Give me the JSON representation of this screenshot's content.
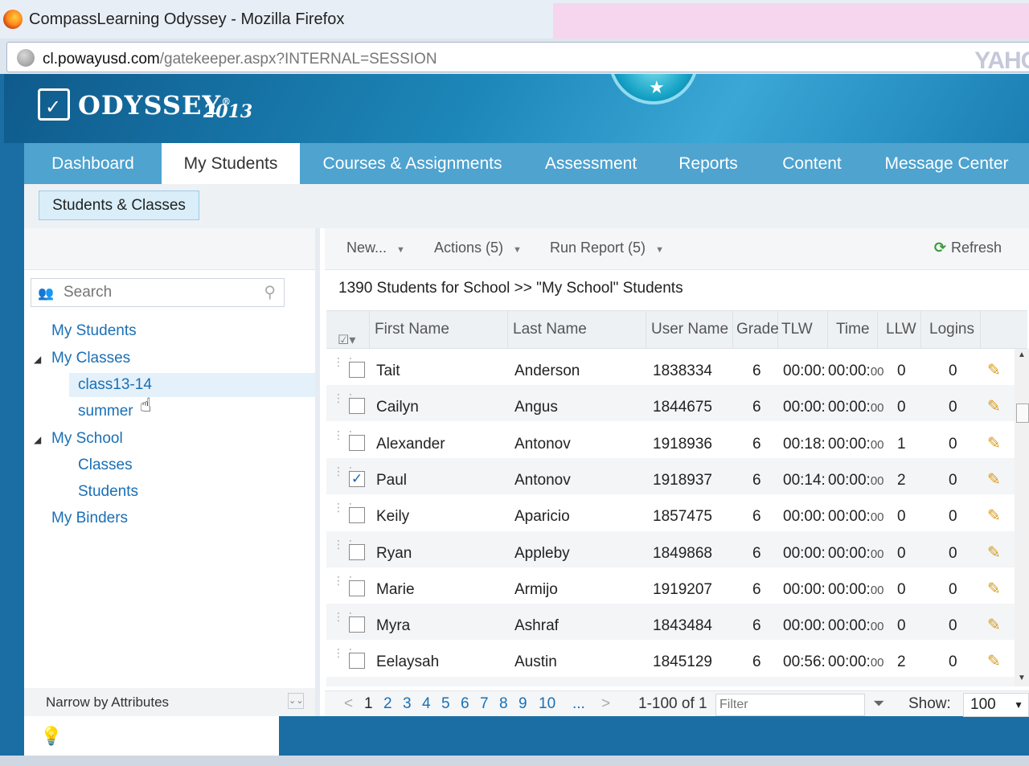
{
  "window": {
    "title": "CompassLearning Odyssey - Mozilla Firefox",
    "url_host": "cl.powayusd.com",
    "url_path": "/gatekeeper.aspx?INTERNAL=SESSION",
    "search_engine": "YAHO"
  },
  "brand": {
    "name": "ODYSSEY",
    "registered": "®",
    "year": "2013",
    "accent": "#4ea3cf"
  },
  "nav": {
    "tabs": [
      {
        "label": "Dashboard"
      },
      {
        "label": "My Students"
      },
      {
        "label": "Courses & Assignments"
      },
      {
        "label": "Assessment"
      },
      {
        "label": "Reports"
      },
      {
        "label": "Content"
      },
      {
        "label": "Message Center"
      }
    ],
    "active": "My Students"
  },
  "subnav": {
    "tab": "Students & Classes"
  },
  "sidebar": {
    "search_placeholder": "Search",
    "tree": {
      "my_students": "My Students",
      "my_classes": "My Classes",
      "class1": "class13-14",
      "class2": "summer",
      "my_school": "My School",
      "classes": "Classes",
      "students": "Students",
      "my_binders": "My Binders"
    },
    "narrow": "Narrow by Attributes"
  },
  "toolbar": {
    "new": "New...",
    "actions": "Actions (5)",
    "run_report": "Run Report (5)",
    "refresh": "Refresh"
  },
  "breadcrumb": "1390 Students for School >> \"My School\" Students",
  "table": {
    "columns": [
      "First Name",
      "Last Name",
      "User Name",
      "Grade",
      "TLW",
      "Time",
      "LLW",
      "Logins"
    ],
    "rows": [
      {
        "first": "Tait",
        "last": "Anderson",
        "user": "1838334",
        "grade": "6",
        "tlw": "00:00:",
        "time": "00:00:",
        "time_s": "00",
        "llw": "0",
        "logins": "0",
        "checked": false
      },
      {
        "first": "Cailyn",
        "last": "Angus",
        "user": "1844675",
        "grade": "6",
        "tlw": "00:00:",
        "time": "00:00:",
        "time_s": "00",
        "llw": "0",
        "logins": "0",
        "checked": false
      },
      {
        "first": "Alexander",
        "last": "Antonov",
        "user": "1918936",
        "grade": "6",
        "tlw": "00:18:",
        "time": "00:00:",
        "time_s": "00",
        "llw": "1",
        "logins": "0",
        "checked": false
      },
      {
        "first": "Paul",
        "last": "Antonov",
        "user": "1918937",
        "grade": "6",
        "tlw": "00:14:",
        "time": "00:00:",
        "time_s": "00",
        "llw": "2",
        "logins": "0",
        "checked": true
      },
      {
        "first": "Keily",
        "last": "Aparicio",
        "user": "1857475",
        "grade": "6",
        "tlw": "00:00:",
        "time": "00:00:",
        "time_s": "00",
        "llw": "0",
        "logins": "0",
        "checked": false
      },
      {
        "first": "Ryan",
        "last": "Appleby",
        "user": "1849868",
        "grade": "6",
        "tlw": "00:00:",
        "time": "00:00:",
        "time_s": "00",
        "llw": "0",
        "logins": "0",
        "checked": false
      },
      {
        "first": "Marie",
        "last": "Armijo",
        "user": "1919207",
        "grade": "6",
        "tlw": "00:00:",
        "time": "00:00:",
        "time_s": "00",
        "llw": "0",
        "logins": "0",
        "checked": false
      },
      {
        "first": "Myra",
        "last": "Ashraf",
        "user": "1843484",
        "grade": "6",
        "tlw": "00:00:",
        "time": "00:00:",
        "time_s": "00",
        "llw": "0",
        "logins": "0",
        "checked": false
      },
      {
        "first": "Eelaysah",
        "last": "Austin",
        "user": "1845129",
        "grade": "6",
        "tlw": "00:56:",
        "time": "00:00:",
        "time_s": "00",
        "llw": "2",
        "logins": "0",
        "checked": false
      }
    ]
  },
  "pager": {
    "prev": "<",
    "pages": [
      "1",
      "2",
      "3",
      "4",
      "5",
      "6",
      "7",
      "8",
      "9",
      "10"
    ],
    "ellipsis": "...",
    "next": ">",
    "range": "1-100 of 1",
    "filter_placeholder": "Filter",
    "show_label": "Show:",
    "show_value": "100"
  }
}
